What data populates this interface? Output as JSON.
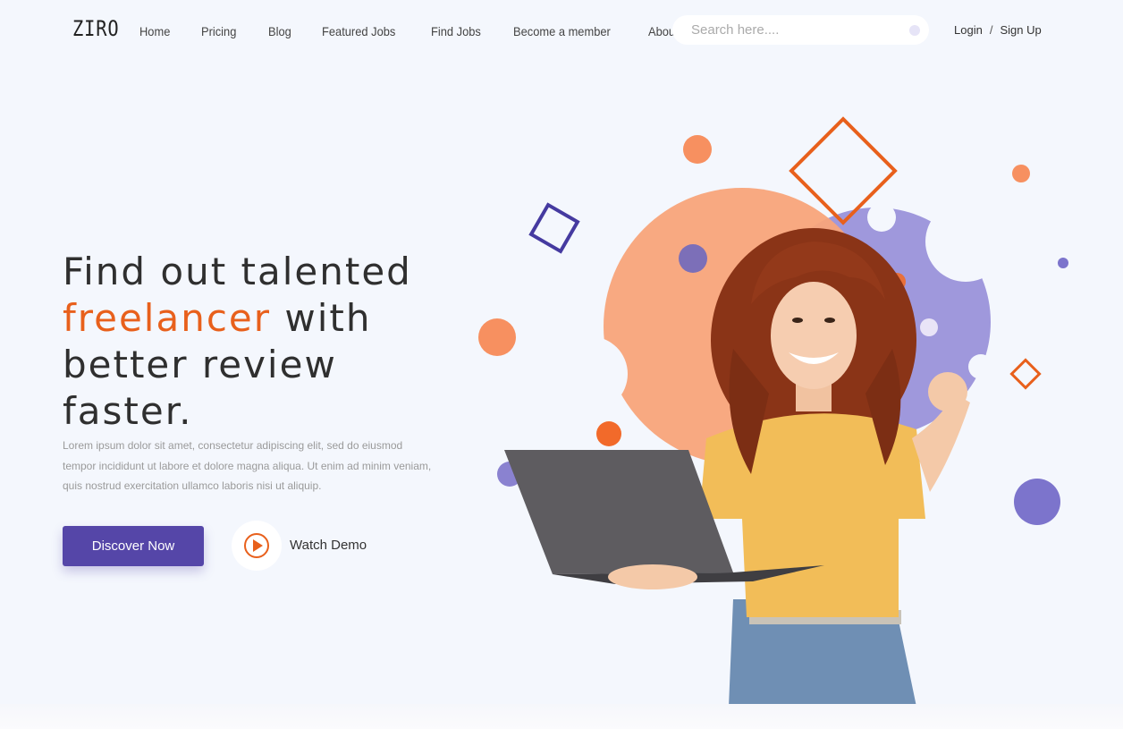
{
  "brand": {
    "logo": "ZIRO"
  },
  "nav": {
    "items": [
      "Home",
      "Pricing",
      "Blog",
      "Featured Jobs",
      "Find Jobs",
      "Become a member",
      "About Us"
    ]
  },
  "search": {
    "placeholder": "Search here....",
    "value": ""
  },
  "auth": {
    "login": "Login",
    "separator": "/",
    "signup": "Sign Up"
  },
  "hero": {
    "headline_line1": "Find out talented",
    "headline_accent": "freelancer",
    "headline_line2_rest": " with",
    "headline_line3": "better review",
    "headline_line4": "faster.",
    "description": "Lorem ipsum dolor sit amet, consectetur adipiscing elit, sed do eiusmod tempor incididunt ut labore et dolore magna aliqua. Ut enim ad minim veniam, quis nostrud exercitation ullamco laboris nisi ut aliquip.",
    "cta_label": "Discover Now",
    "demo_label": "Watch Demo"
  },
  "colors": {
    "accent": "#e8601c",
    "primary": "#5546a8",
    "peach": "#f8a47a",
    "lavender": "#9f98dc",
    "background": "#f4f7fd"
  },
  "icons": {
    "play": "play-icon",
    "search": "search-icon"
  }
}
